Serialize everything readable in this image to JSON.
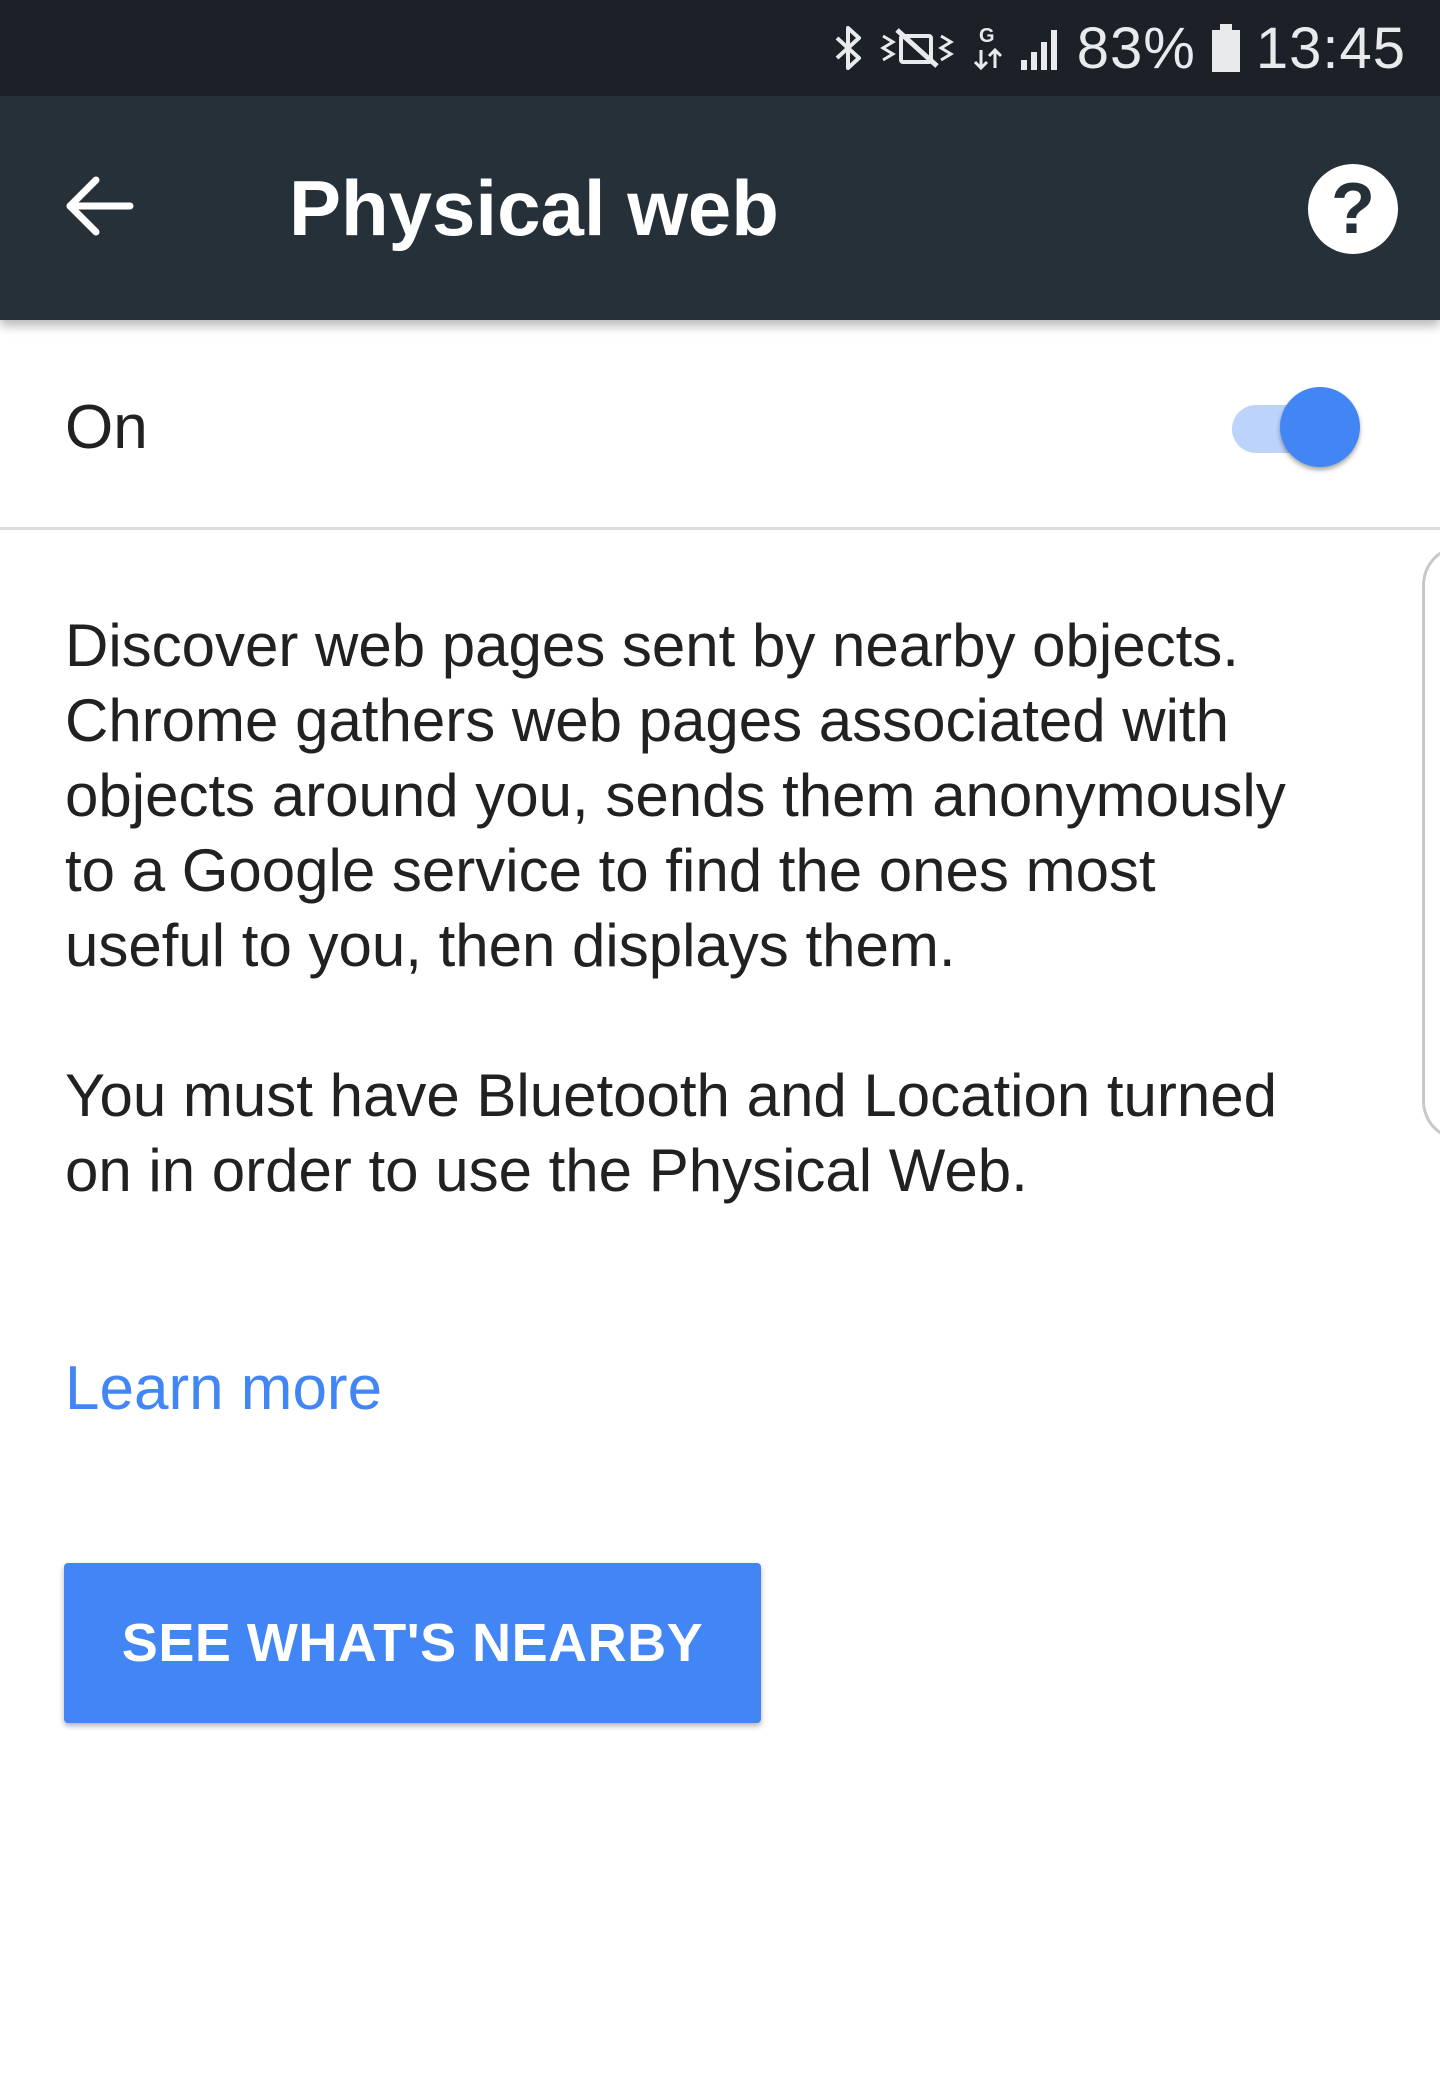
{
  "status_bar": {
    "icons": [
      "bluetooth-icon",
      "mute-icon",
      "data-transfer-icon",
      "signal-icon",
      "battery-icon"
    ],
    "data_indicator": "G",
    "battery_percent": "83%",
    "time": "13:45"
  },
  "app_bar": {
    "title": "Physical web",
    "back_icon": "arrow-left-icon",
    "help_icon": "help-circle-icon",
    "help_glyph": "?"
  },
  "toggle": {
    "label": "On",
    "state": "on",
    "accent_color": "#4285f4",
    "track_color": "#bcd3fb"
  },
  "description": {
    "paragraph_1": "Discover web pages sent by nearby objects.\nChrome gathers web pages associated with\nobjects around you, sends them anonymously\nto a Google service to find the ones most\nuseful to you, then displays them.",
    "paragraph_2": "You must have Bluetooth and Location turned\non in order to use the Physical Web."
  },
  "learn_more": {
    "label": "Learn more"
  },
  "nearby_button": {
    "label": "SEE WHAT'S NEARBY"
  },
  "colors": {
    "status_bar_bg": "#1b2126",
    "app_bar_bg": "#263039",
    "link": "#4285f4",
    "button_bg": "#4285f4",
    "body_text": "#212121"
  }
}
